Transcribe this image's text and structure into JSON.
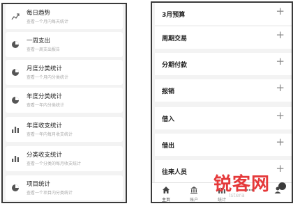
{
  "left_screen": {
    "items": [
      {
        "title": "每日趋势",
        "subtitle": "查看一个月内每天统计",
        "icon": "trend-line-icon"
      },
      {
        "title": "一周支出",
        "subtitle": "查看一周支出报告",
        "icon": "pie-chart-icon"
      },
      {
        "title": "月度分类统计",
        "subtitle": "查看一个月内分类统计",
        "icon": "pie-chart-icon"
      },
      {
        "title": "年度分类统计",
        "subtitle": "查看一年内分类统计",
        "icon": "pie-chart-icon"
      },
      {
        "title": "年度收支统计",
        "subtitle": "查看一年内每月收支统计",
        "icon": "bar-chart-icon"
      },
      {
        "title": "分类收支统计",
        "subtitle": "查看一个分类的每月收支统计",
        "icon": "bar-chart-icon"
      },
      {
        "title": "项目统计",
        "subtitle": "查看一个项目内分类统计",
        "icon": "pie-chart-icon"
      }
    ]
  },
  "right_screen": {
    "items": [
      {
        "label": "3月预算"
      },
      {
        "label": "周期交易"
      },
      {
        "label": "分期付款"
      },
      {
        "label": "报销"
      },
      {
        "label": "借入"
      },
      {
        "label": "借出"
      },
      {
        "label": "往来人员"
      }
    ],
    "plus_symbol": "+",
    "tabbar": [
      {
        "label": "主页",
        "icon": "home-icon"
      },
      {
        "label": "账户",
        "icon": "bank-icon"
      },
      {
        "label": "统计",
        "icon": "chart-icon"
      },
      {
        "label": "",
        "icon": "more-icon"
      },
      {
        "label": "",
        "icon": "user-icon"
      }
    ]
  },
  "watermark": {
    "main": "锐客网",
    "sub": "Istera"
  },
  "colors": {
    "watermark_red": "#e5393a",
    "background_gray": "#f3f3f3"
  }
}
